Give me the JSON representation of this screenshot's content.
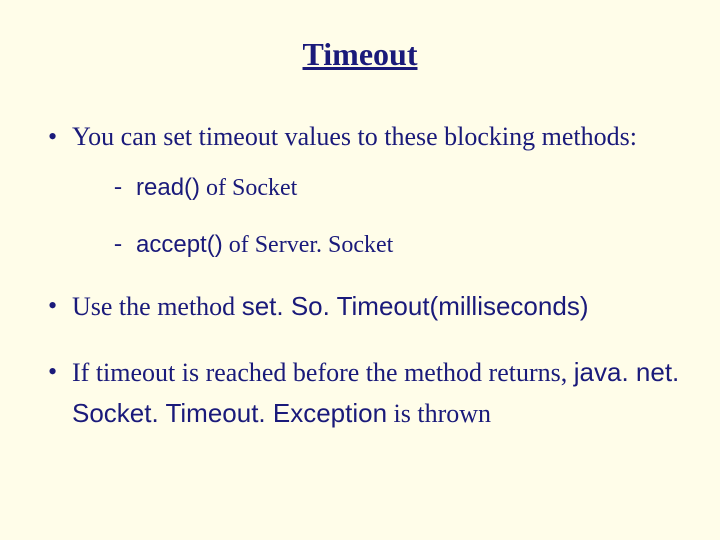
{
  "title": "Timeout",
  "bullets": {
    "b1_pre": "You can set timeout values to these blocking methods:",
    "b1_sub1_code": "read()",
    "b1_sub1_rest": " of Socket",
    "b1_sub2_code": "accept()",
    "b1_sub2_rest": " of Server. Socket",
    "b2_pre": "Use the method ",
    "b2_code": "set. So. Timeout(milliseconds)",
    "b3_pre": "If timeout is reached before the method returns, ",
    "b3_code": "java. net. Socket. Timeout. Exception",
    "b3_post": " is thrown"
  }
}
